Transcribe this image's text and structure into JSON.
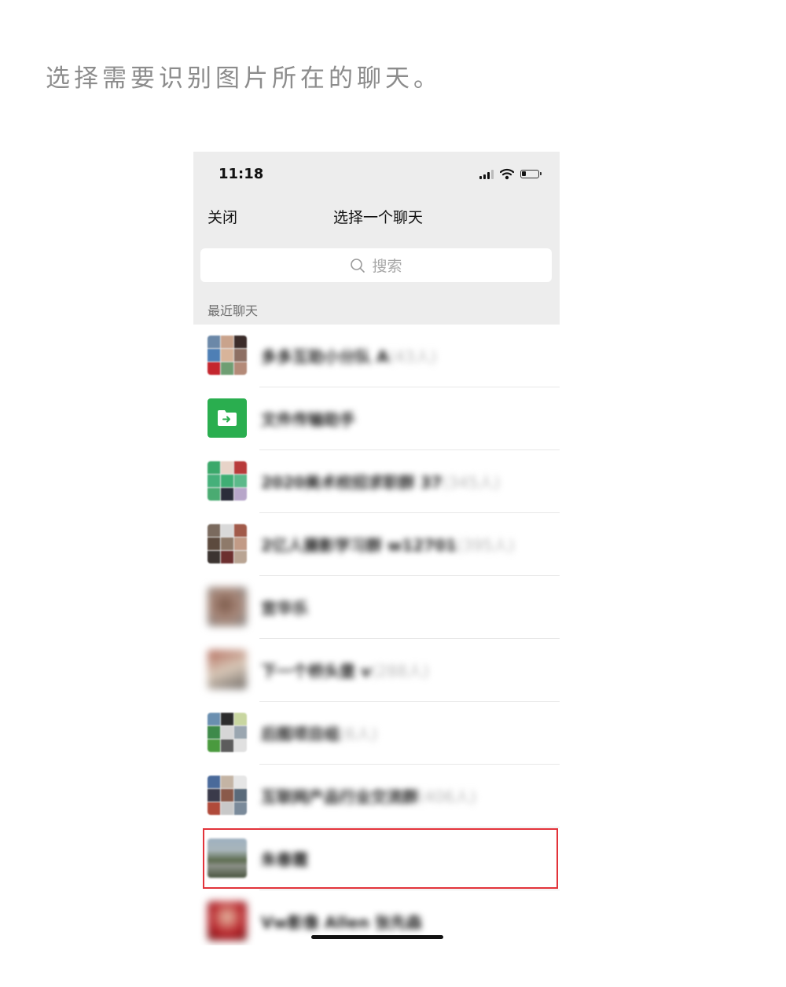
{
  "instruction": "选择需要识别图片所在的聊天。",
  "status": {
    "time": "11:18"
  },
  "nav": {
    "close_label": "关闭",
    "title": "选择一个聊天"
  },
  "search": {
    "placeholder": "搜索"
  },
  "section_label": "最近聊天",
  "chats": [
    {
      "name": "多多互助小分队 A",
      "count": "(43人)",
      "avatar": "group-grid"
    },
    {
      "name": "文件传输助手",
      "count": "",
      "avatar": "file-transfer"
    },
    {
      "name": "2020美术校招求职群 37",
      "count": "(345人)",
      "avatar": "group-grid"
    },
    {
      "name": "2亿人摄影学习群 w12701",
      "count": "(395人)",
      "avatar": "group-grid"
    },
    {
      "name": "宫华乐",
      "count": "",
      "avatar": "photo"
    },
    {
      "name": "下一个桥头堡 v",
      "count": "(288人)",
      "avatar": "photo"
    },
    {
      "name": "后图项目组",
      "count": "(6人)",
      "avatar": "group-grid"
    },
    {
      "name": "互联网产品行业交流群",
      "count": "(406人)",
      "avatar": "group-grid"
    },
    {
      "name": "朱春霞",
      "count": "",
      "avatar": "photo"
    },
    {
      "name": "Vw影像 Allen 张先森",
      "count": "",
      "avatar": "photo"
    }
  ],
  "colors": {
    "highlight": "#e2333a",
    "file_helper_green": "#2aae4f",
    "nav_background": "#ededed"
  },
  "icons": [
    "signal-icon",
    "wifi-icon",
    "battery-icon",
    "search-icon",
    "folder-icon"
  ]
}
